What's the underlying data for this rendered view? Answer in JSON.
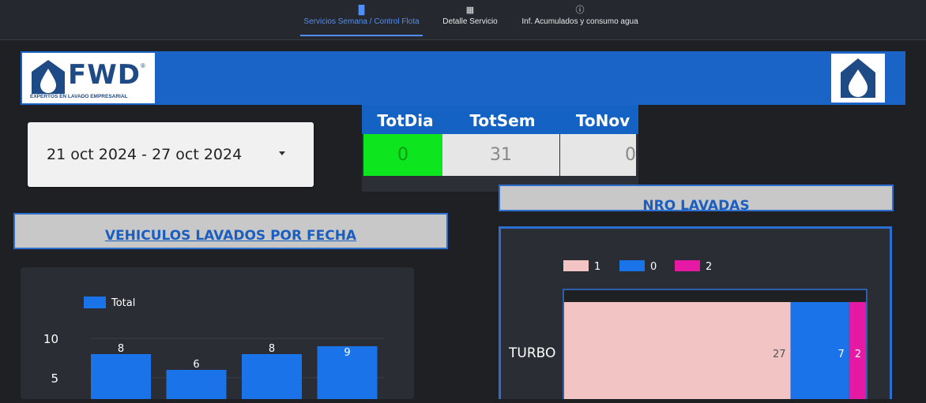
{
  "nav": {
    "tabs": [
      {
        "label": "Servicios Semana / Control Flota",
        "icon": "bar-chart-icon",
        "active": true
      },
      {
        "label": "Detalle Servicio",
        "icon": "grid-icon",
        "active": false
      },
      {
        "label": "Inf. Acumulados y consumo agua",
        "icon": "info-icon",
        "active": false
      }
    ]
  },
  "banner": {
    "logo_text": "FWD",
    "logo_registered": "®",
    "logo_subtitle": "EXPERTOS EN LAVADO EMPRESARIAL"
  },
  "date_range": {
    "value": "21 oct 2024 - 27 oct 2024"
  },
  "kpis": {
    "headers": [
      "TotDia",
      "TotSem",
      "ToNov"
    ],
    "values": [
      "0",
      "31",
      "0"
    ]
  },
  "sections": {
    "left_title": "VEHICULOS LAVADOS POR FECHA",
    "right_title": "NRO LAVADAS"
  },
  "colors": {
    "accent": "#1a63c7",
    "bar": "#1a73e8",
    "kpi_green": "#0de61e",
    "kpi_grey": "#e6e6e6",
    "seg_1": "#f2c4c4",
    "seg_0": "#1a73e8",
    "seg_2": "#e619a5"
  },
  "chart_data": [
    {
      "type": "bar",
      "legend": [
        "Total"
      ],
      "categories": [
        "",
        "",
        "",
        ""
      ],
      "series": [
        {
          "name": "Total",
          "values": [
            8,
            6,
            8,
            9
          ]
        }
      ],
      "y_ticks": [
        5,
        10
      ],
      "ylim": [
        0,
        12
      ]
    },
    {
      "type": "bar",
      "orientation": "horizontal-stacked",
      "legend": [
        "1",
        "0",
        "2"
      ],
      "categories": [
        "TURBO"
      ],
      "series": [
        {
          "name": "1",
          "values": [
            27
          ]
        },
        {
          "name": "0",
          "values": [
            7
          ]
        },
        {
          "name": "2",
          "values": [
            2
          ]
        }
      ]
    }
  ]
}
